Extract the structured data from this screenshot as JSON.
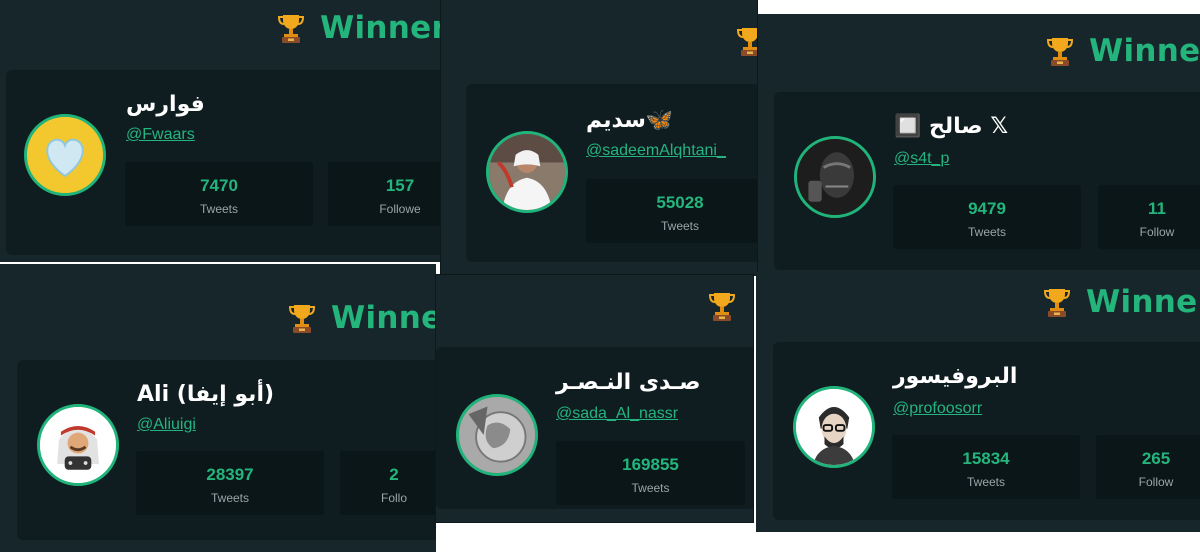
{
  "winner_label": "Winner",
  "stat_labels": {
    "tweets": "Tweets",
    "followers": "Followe",
    "followers_short": "Follo",
    "followers_mid": "Follow"
  },
  "cards": [
    {
      "name": "فوارس",
      "handle": "@Fwaars",
      "tweets": "7470",
      "followers": "157",
      "avatar": "gold-heart-avatar"
    },
    {
      "name": "🦋سديم",
      "handle": "@sadeemAlqhtani_",
      "tweets": "55028",
      "avatar": "man-in-thobe-avatar"
    },
    {
      "name": "𝕏 صالح 🔲",
      "handle": "@s4t_p",
      "tweets": "9479",
      "followers": "11",
      "avatar": "dark-mask-avatar"
    },
    {
      "name": "Ali (أبو إيفا)",
      "handle": "@Aliuigi",
      "tweets": "28397",
      "followers": "2",
      "avatar": "cartoon-gamer-avatar"
    },
    {
      "name": "صـدى النـصـر",
      "handle": "@sada_Al_nassr",
      "tweets": "169855",
      "avatar": "coin-portrait-avatar"
    },
    {
      "name": "البروفيسور",
      "handle": "@profoosorr",
      "tweets": "15834",
      "followers": "265",
      "avatar": "professor-sketch-avatar"
    }
  ]
}
